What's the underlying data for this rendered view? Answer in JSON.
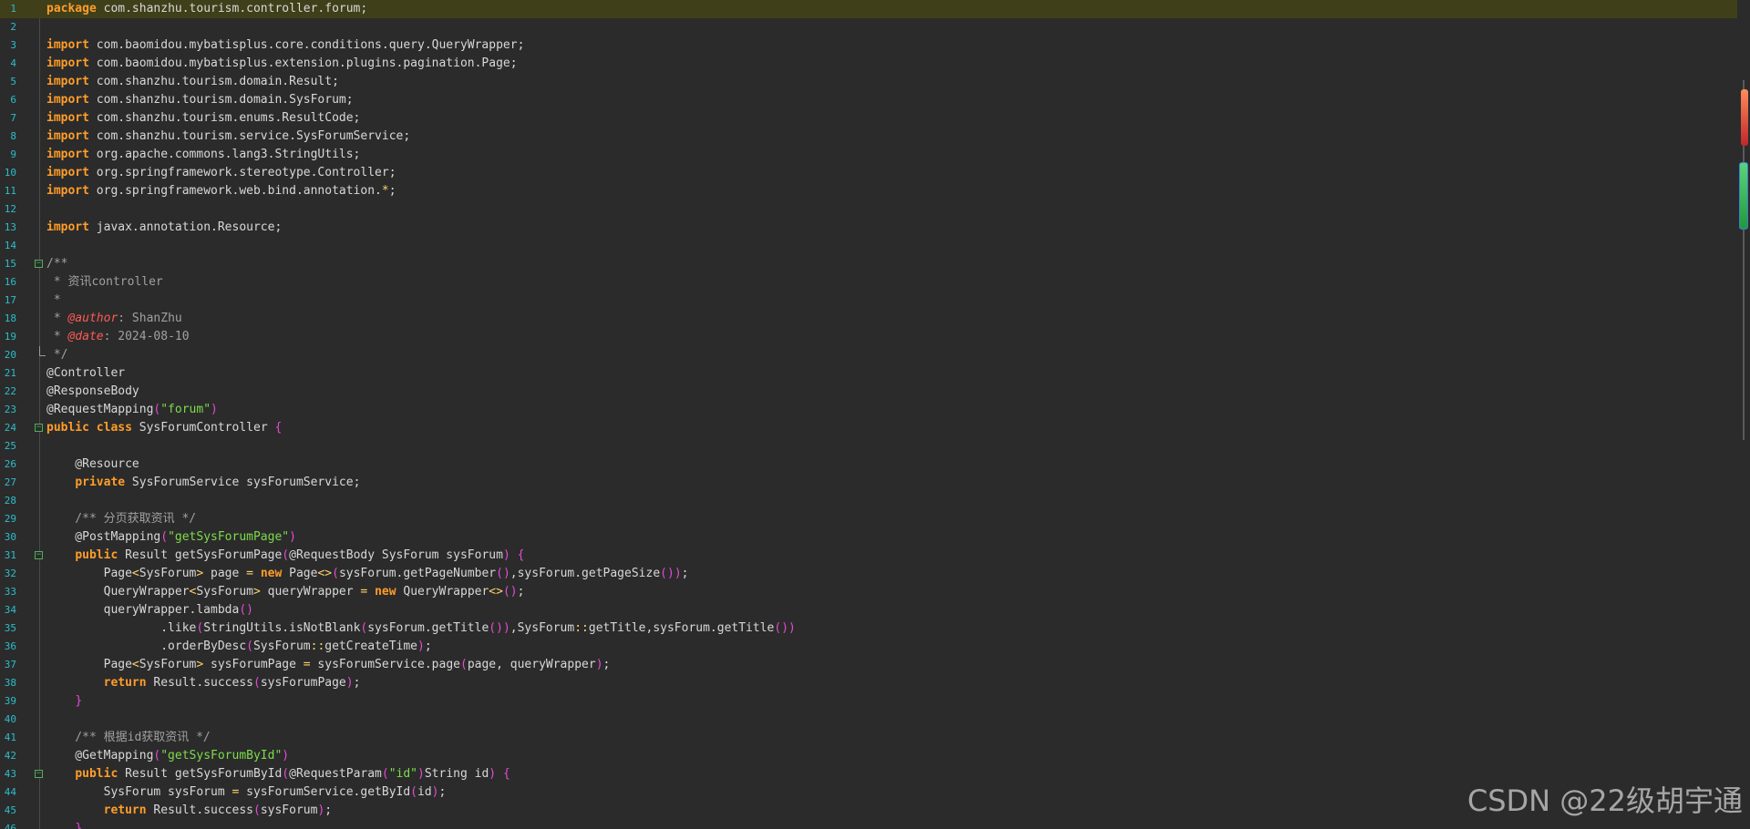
{
  "editor": {
    "lines": [
      {
        "n": "1",
        "t": "package com.shanzhu.tourism.controller.forum;"
      },
      {
        "n": "2",
        "t": ""
      },
      {
        "n": "3",
        "t": "import com.baomidou.mybatisplus.core.conditions.query.QueryWrapper;"
      },
      {
        "n": "4",
        "t": "import com.baomidou.mybatisplus.extension.plugins.pagination.Page;"
      },
      {
        "n": "5",
        "t": "import com.shanzhu.tourism.domain.Result;"
      },
      {
        "n": "6",
        "t": "import com.shanzhu.tourism.domain.SysForum;"
      },
      {
        "n": "7",
        "t": "import com.shanzhu.tourism.enums.ResultCode;"
      },
      {
        "n": "8",
        "t": "import com.shanzhu.tourism.service.SysForumService;"
      },
      {
        "n": "9",
        "t": "import org.apache.commons.lang3.StringUtils;"
      },
      {
        "n": "10",
        "t": "import org.springframework.stereotype.Controller;"
      },
      {
        "n": "11",
        "t": "import org.springframework.web.bind.annotation.*;"
      },
      {
        "n": "12",
        "t": ""
      },
      {
        "n": "13",
        "t": "import javax.annotation.Resource;"
      },
      {
        "n": "14",
        "t": ""
      },
      {
        "n": "15",
        "t": "/**"
      },
      {
        "n": "16",
        "t": " * 资讯controller"
      },
      {
        "n": "17",
        "t": " *"
      },
      {
        "n": "18",
        "t": " * @author: ShanZhu"
      },
      {
        "n": "19",
        "t": " * @date: 2024-08-10"
      },
      {
        "n": "20",
        "t": " */"
      },
      {
        "n": "21",
        "t": "@Controller"
      },
      {
        "n": "22",
        "t": "@ResponseBody"
      },
      {
        "n": "23",
        "t": "@RequestMapping(\"forum\")"
      },
      {
        "n": "24",
        "t": "public class SysForumController {"
      },
      {
        "n": "25",
        "t": ""
      },
      {
        "n": "26",
        "t": "    @Resource"
      },
      {
        "n": "27",
        "t": "    private SysForumService sysForumService;"
      },
      {
        "n": "28",
        "t": ""
      },
      {
        "n": "29",
        "t": "    /** 分页获取资讯 */"
      },
      {
        "n": "30",
        "t": "    @PostMapping(\"getSysForumPage\")"
      },
      {
        "n": "31",
        "t": "    public Result getSysForumPage(@RequestBody SysForum sysForum) {"
      },
      {
        "n": "32",
        "t": "        Page<SysForum> page = new Page<>(sysForum.getPageNumber(),sysForum.getPageSize());"
      },
      {
        "n": "33",
        "t": "        QueryWrapper<SysForum> queryWrapper = new QueryWrapper<>();"
      },
      {
        "n": "34",
        "t": "        queryWrapper.lambda()"
      },
      {
        "n": "35",
        "t": "                .like(StringUtils.isNotBlank(sysForum.getTitle()),SysForum::getTitle,sysForum.getTitle())"
      },
      {
        "n": "36",
        "t": "                .orderByDesc(SysForum::getCreateTime);"
      },
      {
        "n": "37",
        "t": "        Page<SysForum> sysForumPage = sysForumService.page(page, queryWrapper);"
      },
      {
        "n": "38",
        "t": "        return Result.success(sysForumPage);"
      },
      {
        "n": "39",
        "t": "    }"
      },
      {
        "n": "40",
        "t": ""
      },
      {
        "n": "41",
        "t": "    /** 根据id获取资讯 */"
      },
      {
        "n": "42",
        "t": "    @GetMapping(\"getSysForumById\")"
      },
      {
        "n": "43",
        "t": "    public Result getSysForumById(@RequestParam(\"id\")String id) {"
      },
      {
        "n": "44",
        "t": "        SysForum sysForum = sysForumService.getById(id);"
      },
      {
        "n": "45",
        "t": "        return Result.success(sysForum);"
      },
      {
        "n": "46",
        "t": "    }"
      }
    ]
  },
  "watermark": "CSDN @22级胡宇通",
  "colors": {
    "background": "#2b2b2b",
    "line_number": "#2dbdca",
    "keyword": "#ff9d2a",
    "string": "#7ddc4b",
    "comment": "#a0a0a0",
    "doc_tag": "#ff5a52",
    "bracket": "#e44bd4",
    "current_line": "#3f3f1a"
  }
}
